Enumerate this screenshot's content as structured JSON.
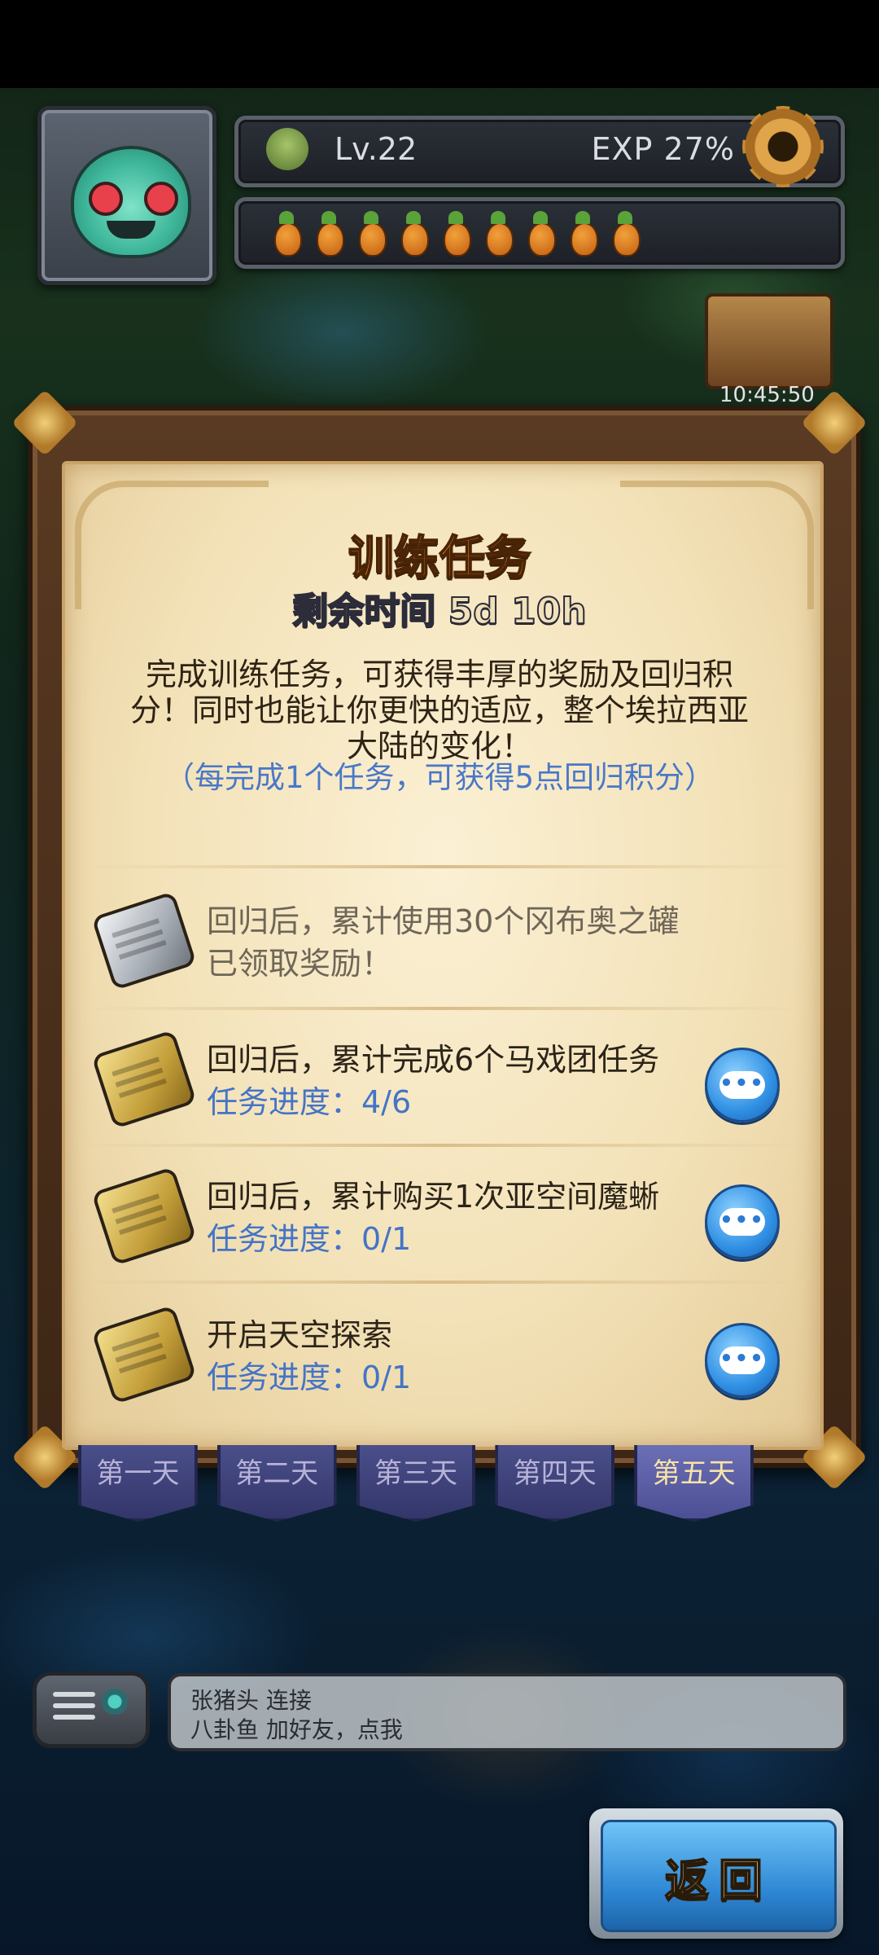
{
  "hud": {
    "level": "Lv.22",
    "exp": "EXP 27%",
    "carrot_count": 9,
    "clock": "10:45:50"
  },
  "panel": {
    "title": "训练任务",
    "remaining_time": "剩余时间 5d 10h",
    "description": "完成训练任务，可获得丰厚的奖励及回归积分！同时也能让你更快的适应，整个埃拉西亚大陆的变化！",
    "note": "（每完成1个任务，可获得5点回归积分）",
    "tasks": [
      {
        "title": "回归后，累计使用30个冈布奥之罐",
        "status": "已领取奖励！",
        "icon": "silver-scroll-icon",
        "completed": true
      },
      {
        "title": "回归后，累计完成6个马戏团任务",
        "status": "任务进度：4/6",
        "icon": "gold-scroll-icon",
        "completed": false
      },
      {
        "title": "回归后，累计购买1次亚空间魔蜥",
        "status": "任务进度：0/1",
        "icon": "gold-scroll-icon",
        "completed": false
      },
      {
        "title": "开启天空探索",
        "status": "任务进度：0/1",
        "icon": "gold-scroll-icon",
        "completed": false
      }
    ]
  },
  "tabs": [
    {
      "label": "第一天",
      "active": false
    },
    {
      "label": "第二天",
      "active": false
    },
    {
      "label": "第三天",
      "active": false
    },
    {
      "label": "第四天",
      "active": false
    },
    {
      "label": "第五天",
      "active": true
    }
  ],
  "chat": {
    "lines": [
      "张猪头 连接",
      "八卦鱼 加好友，点我"
    ]
  },
  "buttons": {
    "return": "返回",
    "more": "•••"
  },
  "colors": {
    "title_orange": "#e9892a",
    "progress_blue": "#4474c6",
    "note_blue": "#4a78c8",
    "button_blue": "#2f8fe3"
  }
}
